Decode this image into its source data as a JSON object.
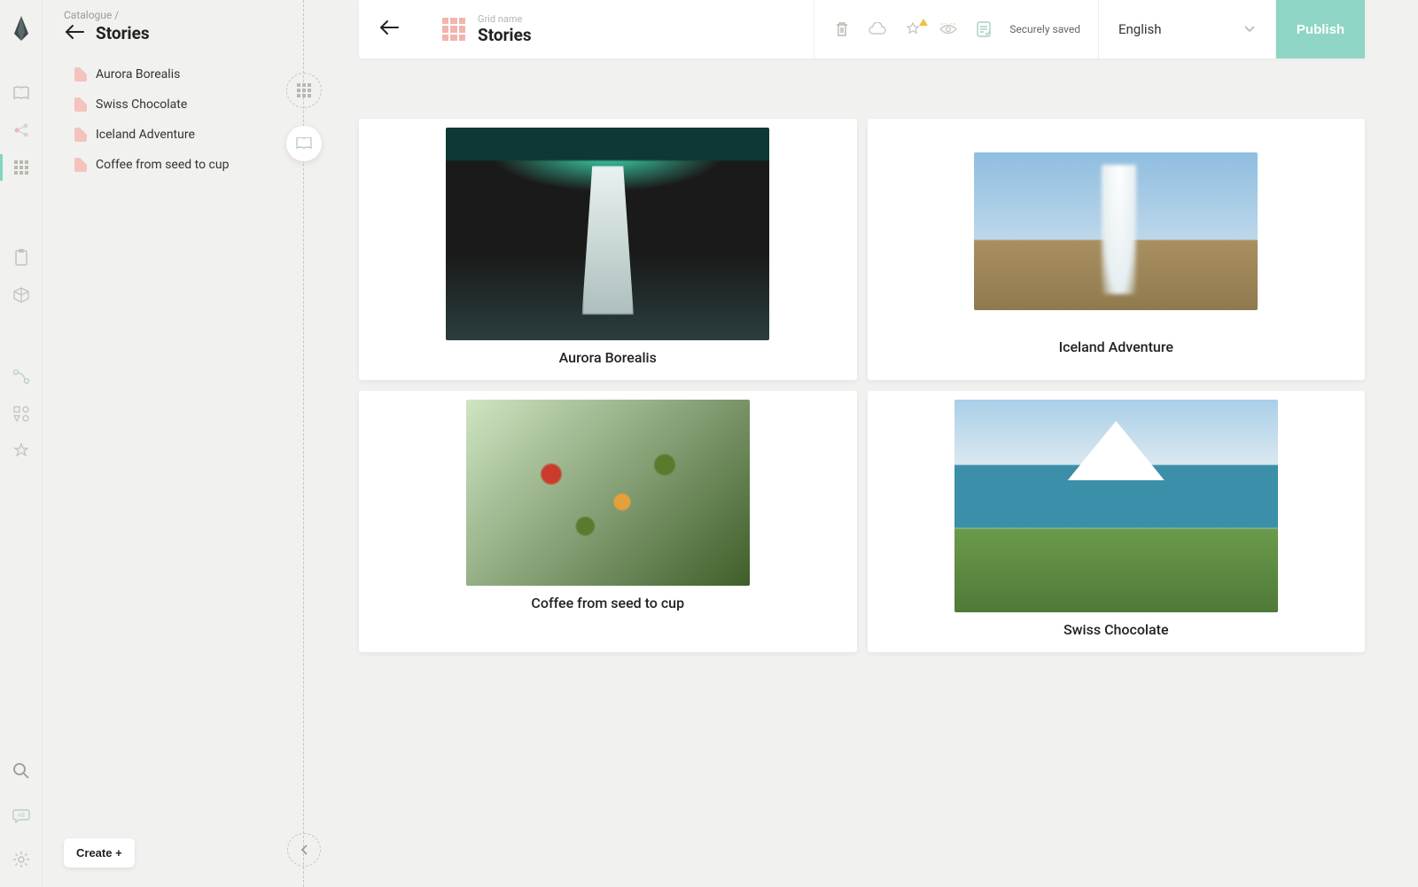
{
  "breadcrumb": "Catalogue /",
  "sidebar": {
    "title": "Stories",
    "items": [
      {
        "label": "Aurora Borealis"
      },
      {
        "label": "Swiss Chocolate"
      },
      {
        "label": "Iceland Adventure"
      },
      {
        "label": "Coffee from seed to cup"
      }
    ],
    "create": "Create +"
  },
  "topbar": {
    "gridLabel": "Grid name",
    "title": "Stories",
    "saveStatus": "Securely saved",
    "language": "English",
    "publish": "Publish"
  },
  "cards": [
    {
      "title": "Aurora Borealis"
    },
    {
      "title": "Iceland Adventure"
    },
    {
      "title": "Coffee from seed to cup"
    },
    {
      "title": "Swiss Chocolate"
    }
  ]
}
